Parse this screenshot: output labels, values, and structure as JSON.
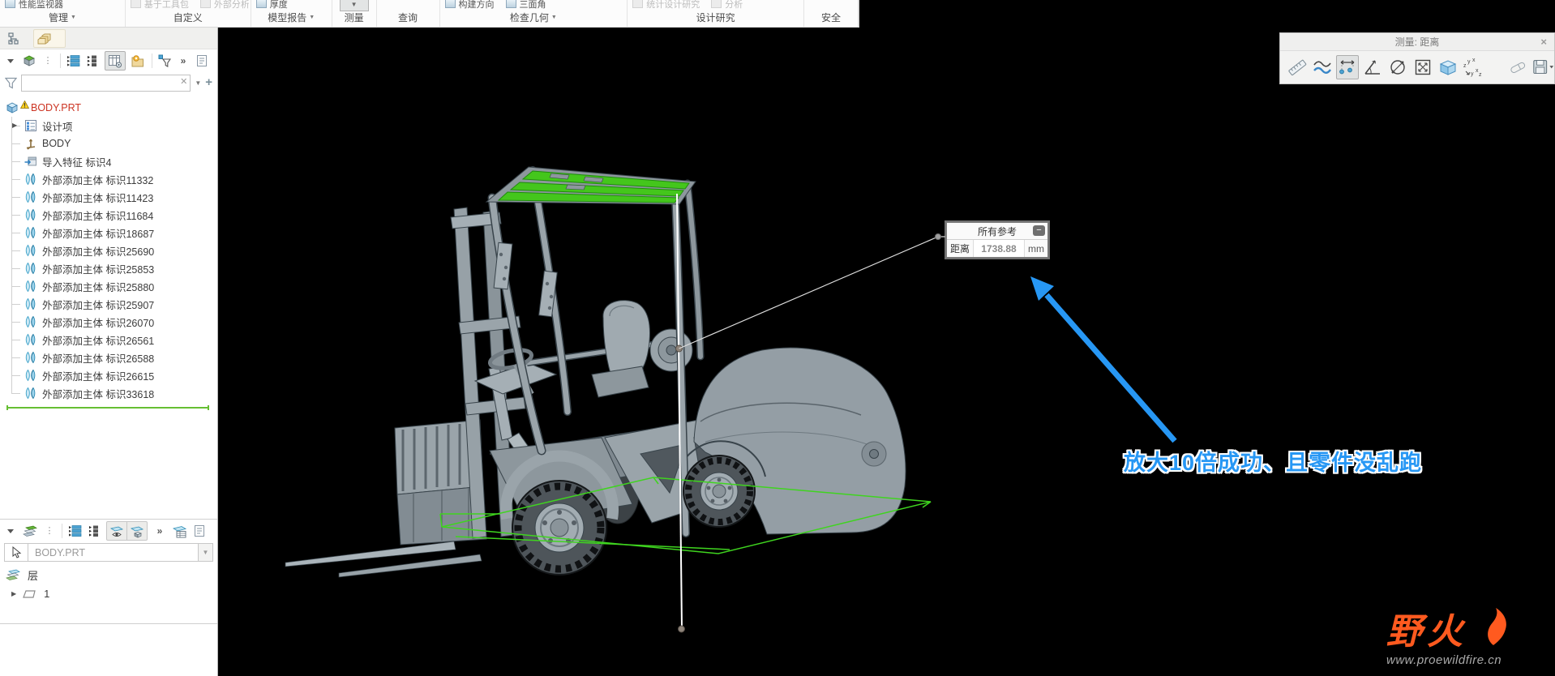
{
  "colors": {
    "highlight_green": "#3fd41f",
    "roof_selection_green": "#44c61c",
    "annotation_blue": "#2797f4",
    "brand_orange": "#ff5a1f",
    "root_item_red": "#cc3322",
    "model_gray": "#9aa4ab"
  },
  "ribbon": {
    "groups": [
      {
        "label": "管理",
        "arrow": true,
        "top": [
          {
            "label": "性能监视器",
            "grayed": false
          }
        ]
      },
      {
        "label": "自定义",
        "arrow": false,
        "top": [
          {
            "label": "基于工具包",
            "grayed": true
          },
          {
            "label": "外部分析",
            "grayed": true
          }
        ]
      },
      {
        "label": "模型报告",
        "arrow": true,
        "top": [
          {
            "label": "厚度",
            "grayed": false
          }
        ]
      },
      {
        "label": "测量",
        "arrow": false,
        "pressed_dropdown": true,
        "top": []
      },
      {
        "label": "查询",
        "arrow": false,
        "top": []
      },
      {
        "label": "检查几何",
        "arrow": true,
        "top": [
          {
            "label": "构建方向",
            "grayed": false
          },
          {
            "label": "三面角",
            "grayed": false
          }
        ]
      },
      {
        "label": "设计研究",
        "arrow": false,
        "top": [
          {
            "label": "统计设计研究",
            "grayed": true
          },
          {
            "label": "分析",
            "grayed": true
          }
        ]
      },
      {
        "label": "安全",
        "arrow": false,
        "top": []
      }
    ]
  },
  "navigator": {
    "search_value": "",
    "tree": {
      "root": {
        "label": "BODY.PRT",
        "icon": "part-cube"
      },
      "items": [
        {
          "label": "设计项",
          "icon": "design-items",
          "expandable": true
        },
        {
          "label": "BODY",
          "icon": "csys"
        },
        {
          "label": "导入特征 标识4",
          "icon": "import-feature"
        },
        {
          "label": "外部添加主体 标识11332",
          "icon": "ext-body"
        },
        {
          "label": "外部添加主体 标识11423",
          "icon": "ext-body"
        },
        {
          "label": "外部添加主体 标识11684",
          "icon": "ext-body"
        },
        {
          "label": "外部添加主体 标识18687",
          "icon": "ext-body"
        },
        {
          "label": "外部添加主体 标识25690",
          "icon": "ext-body"
        },
        {
          "label": "外部添加主体 标识25853",
          "icon": "ext-body"
        },
        {
          "label": "外部添加主体 标识25880",
          "icon": "ext-body"
        },
        {
          "label": "外部添加主体 标识25907",
          "icon": "ext-body"
        },
        {
          "label": "外部添加主体 标识26070",
          "icon": "ext-body"
        },
        {
          "label": "外部添加主体 标识26561",
          "icon": "ext-body"
        },
        {
          "label": "外部添加主体 标识26588",
          "icon": "ext-body"
        },
        {
          "label": "外部添加主体 标识26615",
          "icon": "ext-body"
        },
        {
          "label": "外部添加主体 标识33618",
          "icon": "ext-body"
        }
      ]
    }
  },
  "layers_panel": {
    "owner": "BODY.PRT",
    "header": "层",
    "items": [
      {
        "label": "1"
      }
    ]
  },
  "measure_palette": {
    "title": "测量: 距离",
    "close": "×"
  },
  "measure_dialog": {
    "header": "所有参考",
    "minimize": "−",
    "row": {
      "label": "距离",
      "value": "1738.88",
      "unit": "mm"
    }
  },
  "annotation": {
    "text": "放大10倍成功、且零件没乱跑"
  },
  "watermark": {
    "brand": "野火",
    "url": "www.proewildfire.cn"
  }
}
